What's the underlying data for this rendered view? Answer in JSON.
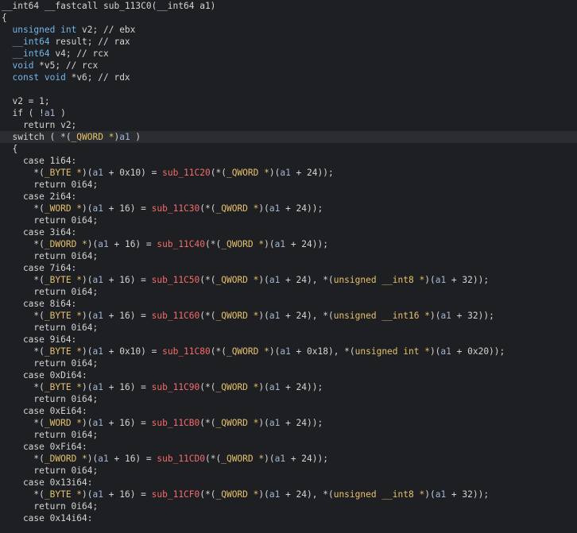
{
  "editor": {
    "highlight_line": 11,
    "colors": {
      "background": "#1e1f22",
      "highlight": "#2b2d31",
      "plain": "#d4d4d4",
      "type": "#6fb7e8",
      "cast_type": "#e5c06b",
      "argument": "#9fb4d3",
      "function": "#f36b6b"
    },
    "lines": [
      [
        {
          "t": "__int64 __fastcall sub_113C0(__int64 a1)",
          "c": "p"
        }
      ],
      [
        {
          "t": "{",
          "c": "p"
        }
      ],
      [
        {
          "t": "  ",
          "c": "p"
        },
        {
          "t": "unsigned int",
          "c": "t"
        },
        {
          "t": " v2; // ebx",
          "c": "p"
        }
      ],
      [
        {
          "t": "  ",
          "c": "p"
        },
        {
          "t": "__int64",
          "c": "t"
        },
        {
          "t": " result; // rax",
          "c": "p"
        }
      ],
      [
        {
          "t": "  ",
          "c": "p"
        },
        {
          "t": "__int64",
          "c": "t"
        },
        {
          "t": " v4; // rcx",
          "c": "p"
        }
      ],
      [
        {
          "t": "  ",
          "c": "p"
        },
        {
          "t": "void",
          "c": "t"
        },
        {
          "t": " *v5; // rcx",
          "c": "p"
        }
      ],
      [
        {
          "t": "  ",
          "c": "p"
        },
        {
          "t": "const void",
          "c": "t"
        },
        {
          "t": " *v6; // rdx",
          "c": "p"
        }
      ],
      [
        {
          "t": "",
          "c": "p"
        }
      ],
      [
        {
          "t": "  v2 = 1;",
          "c": "p"
        }
      ],
      [
        {
          "t": "  if ( !",
          "c": "p"
        },
        {
          "t": "a1",
          "c": "a"
        },
        {
          "t": " )",
          "c": "p"
        }
      ],
      [
        {
          "t": "    return v2;",
          "c": "p"
        }
      ],
      [
        {
          "t": "  switch ( *(",
          "c": "p"
        },
        {
          "t": "_QWORD *",
          "c": "tq"
        },
        {
          "t": ")",
          "c": "p"
        },
        {
          "t": "a1",
          "c": "a"
        },
        {
          "t": " )",
          "c": "p"
        }
      ],
      [
        {
          "t": "  {",
          "c": "p"
        }
      ],
      [
        {
          "t": "    case 1i64:",
          "c": "p"
        }
      ],
      [
        {
          "t": "      *(",
          "c": "p"
        },
        {
          "t": "_BYTE *",
          "c": "tq"
        },
        {
          "t": ")(",
          "c": "p"
        },
        {
          "t": "a1",
          "c": "a"
        },
        {
          "t": " + 0x10) = ",
          "c": "p"
        },
        {
          "t": "sub_11C20",
          "c": "f"
        },
        {
          "t": "(*(",
          "c": "p"
        },
        {
          "t": "_QWORD *",
          "c": "tq"
        },
        {
          "t": ")(",
          "c": "p"
        },
        {
          "t": "a1",
          "c": "a"
        },
        {
          "t": " + 24));",
          "c": "p"
        }
      ],
      [
        {
          "t": "      return 0i64;",
          "c": "p"
        }
      ],
      [
        {
          "t": "    case 2i64:",
          "c": "p"
        }
      ],
      [
        {
          "t": "      *(",
          "c": "p"
        },
        {
          "t": "_WORD *",
          "c": "tq"
        },
        {
          "t": ")(",
          "c": "p"
        },
        {
          "t": "a1",
          "c": "a"
        },
        {
          "t": " + 16) = ",
          "c": "p"
        },
        {
          "t": "sub_11C30",
          "c": "f"
        },
        {
          "t": "(*(",
          "c": "p"
        },
        {
          "t": "_QWORD *",
          "c": "tq"
        },
        {
          "t": ")(",
          "c": "p"
        },
        {
          "t": "a1",
          "c": "a"
        },
        {
          "t": " + 24));",
          "c": "p"
        }
      ],
      [
        {
          "t": "      return 0i64;",
          "c": "p"
        }
      ],
      [
        {
          "t": "    case 3i64:",
          "c": "p"
        }
      ],
      [
        {
          "t": "      *(",
          "c": "p"
        },
        {
          "t": "_DWORD *",
          "c": "tq"
        },
        {
          "t": ")(",
          "c": "p"
        },
        {
          "t": "a1",
          "c": "a"
        },
        {
          "t": " + 16) = ",
          "c": "p"
        },
        {
          "t": "sub_11C40",
          "c": "f"
        },
        {
          "t": "(*(",
          "c": "p"
        },
        {
          "t": "_QWORD *",
          "c": "tq"
        },
        {
          "t": ")(",
          "c": "p"
        },
        {
          "t": "a1",
          "c": "a"
        },
        {
          "t": " + 24));",
          "c": "p"
        }
      ],
      [
        {
          "t": "      return 0i64;",
          "c": "p"
        }
      ],
      [
        {
          "t": "    case 7i64:",
          "c": "p"
        }
      ],
      [
        {
          "t": "      *(",
          "c": "p"
        },
        {
          "t": "_BYTE *",
          "c": "tq"
        },
        {
          "t": ")(",
          "c": "p"
        },
        {
          "t": "a1",
          "c": "a"
        },
        {
          "t": " + 16) = ",
          "c": "p"
        },
        {
          "t": "sub_11C50",
          "c": "f"
        },
        {
          "t": "(*(",
          "c": "p"
        },
        {
          "t": "_QWORD *",
          "c": "tq"
        },
        {
          "t": ")(",
          "c": "p"
        },
        {
          "t": "a1",
          "c": "a"
        },
        {
          "t": " + 24), *(",
          "c": "p"
        },
        {
          "t": "unsigned __int8 *",
          "c": "tq"
        },
        {
          "t": ")(",
          "c": "p"
        },
        {
          "t": "a1",
          "c": "a"
        },
        {
          "t": " + 32));",
          "c": "p"
        }
      ],
      [
        {
          "t": "      return 0i64;",
          "c": "p"
        }
      ],
      [
        {
          "t": "    case 8i64:",
          "c": "p"
        }
      ],
      [
        {
          "t": "      *(",
          "c": "p"
        },
        {
          "t": "_BYTE *",
          "c": "tq"
        },
        {
          "t": ")(",
          "c": "p"
        },
        {
          "t": "a1",
          "c": "a"
        },
        {
          "t": " + 16) = ",
          "c": "p"
        },
        {
          "t": "sub_11C60",
          "c": "f"
        },
        {
          "t": "(*(",
          "c": "p"
        },
        {
          "t": "_QWORD *",
          "c": "tq"
        },
        {
          "t": ")(",
          "c": "p"
        },
        {
          "t": "a1",
          "c": "a"
        },
        {
          "t": " + 24), *(",
          "c": "p"
        },
        {
          "t": "unsigned __int16 *",
          "c": "tq"
        },
        {
          "t": ")(",
          "c": "p"
        },
        {
          "t": "a1",
          "c": "a"
        },
        {
          "t": " + 32));",
          "c": "p"
        }
      ],
      [
        {
          "t": "      return 0i64;",
          "c": "p"
        }
      ],
      [
        {
          "t": "    case 9i64:",
          "c": "p"
        }
      ],
      [
        {
          "t": "      *(",
          "c": "p"
        },
        {
          "t": "_BYTE *",
          "c": "tq"
        },
        {
          "t": ")(",
          "c": "p"
        },
        {
          "t": "a1",
          "c": "a"
        },
        {
          "t": " + 0x10) = ",
          "c": "p"
        },
        {
          "t": "sub_11C80",
          "c": "f"
        },
        {
          "t": "(*(",
          "c": "p"
        },
        {
          "t": "_QWORD *",
          "c": "tq"
        },
        {
          "t": ")(",
          "c": "p"
        },
        {
          "t": "a1",
          "c": "a"
        },
        {
          "t": " + 0x18), *(",
          "c": "p"
        },
        {
          "t": "unsigned int *",
          "c": "tq"
        },
        {
          "t": ")(",
          "c": "p"
        },
        {
          "t": "a1",
          "c": "a"
        },
        {
          "t": " + 0x20));",
          "c": "p"
        }
      ],
      [
        {
          "t": "      return 0i64;",
          "c": "p"
        }
      ],
      [
        {
          "t": "    case 0xDi64:",
          "c": "p"
        }
      ],
      [
        {
          "t": "      *(",
          "c": "p"
        },
        {
          "t": "_BYTE *",
          "c": "tq"
        },
        {
          "t": ")(",
          "c": "p"
        },
        {
          "t": "a1",
          "c": "a"
        },
        {
          "t": " + 16) = ",
          "c": "p"
        },
        {
          "t": "sub_11C90",
          "c": "f"
        },
        {
          "t": "(*(",
          "c": "p"
        },
        {
          "t": "_QWORD *",
          "c": "tq"
        },
        {
          "t": ")(",
          "c": "p"
        },
        {
          "t": "a1",
          "c": "a"
        },
        {
          "t": " + 24));",
          "c": "p"
        }
      ],
      [
        {
          "t": "      return 0i64;",
          "c": "p"
        }
      ],
      [
        {
          "t": "    case 0xEi64:",
          "c": "p"
        }
      ],
      [
        {
          "t": "      *(",
          "c": "p"
        },
        {
          "t": "_WORD *",
          "c": "tq"
        },
        {
          "t": ")(",
          "c": "p"
        },
        {
          "t": "a1",
          "c": "a"
        },
        {
          "t": " + 16) = ",
          "c": "p"
        },
        {
          "t": "sub_11CB0",
          "c": "f"
        },
        {
          "t": "(*(",
          "c": "p"
        },
        {
          "t": "_QWORD *",
          "c": "tq"
        },
        {
          "t": ")(",
          "c": "p"
        },
        {
          "t": "a1",
          "c": "a"
        },
        {
          "t": " + 24));",
          "c": "p"
        }
      ],
      [
        {
          "t": "      return 0i64;",
          "c": "p"
        }
      ],
      [
        {
          "t": "    case 0xFi64:",
          "c": "p"
        }
      ],
      [
        {
          "t": "      *(",
          "c": "p"
        },
        {
          "t": "_DWORD *",
          "c": "tq"
        },
        {
          "t": ")(",
          "c": "p"
        },
        {
          "t": "a1",
          "c": "a"
        },
        {
          "t": " + 16) = ",
          "c": "p"
        },
        {
          "t": "sub_11CD0",
          "c": "f"
        },
        {
          "t": "(*(",
          "c": "p"
        },
        {
          "t": "_QWORD *",
          "c": "tq"
        },
        {
          "t": ")(",
          "c": "p"
        },
        {
          "t": "a1",
          "c": "a"
        },
        {
          "t": " + 24));",
          "c": "p"
        }
      ],
      [
        {
          "t": "      return 0i64;",
          "c": "p"
        }
      ],
      [
        {
          "t": "    case 0x13i64:",
          "c": "p"
        }
      ],
      [
        {
          "t": "      *(",
          "c": "p"
        },
        {
          "t": "_BYTE *",
          "c": "tq"
        },
        {
          "t": ")(",
          "c": "p"
        },
        {
          "t": "a1",
          "c": "a"
        },
        {
          "t": " + 16) = ",
          "c": "p"
        },
        {
          "t": "sub_11CF0",
          "c": "f"
        },
        {
          "t": "(*(",
          "c": "p"
        },
        {
          "t": "_QWORD *",
          "c": "tq"
        },
        {
          "t": ")(",
          "c": "p"
        },
        {
          "t": "a1",
          "c": "a"
        },
        {
          "t": " + 24), *(",
          "c": "p"
        },
        {
          "t": "unsigned __int8 *",
          "c": "tq"
        },
        {
          "t": ")(",
          "c": "p"
        },
        {
          "t": "a1",
          "c": "a"
        },
        {
          "t": " + 32));",
          "c": "p"
        }
      ],
      [
        {
          "t": "      return 0i64;",
          "c": "p"
        }
      ],
      [
        {
          "t": "    case 0x14i64:",
          "c": "p"
        }
      ]
    ]
  }
}
